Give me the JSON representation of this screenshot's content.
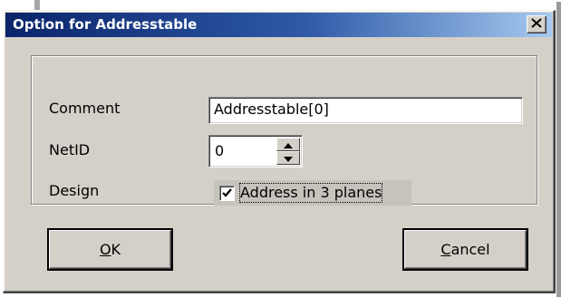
{
  "dialog": {
    "title": "Option for Addresstable",
    "close_icon": "close-x-icon"
  },
  "form": {
    "comment": {
      "label": "Comment",
      "value": "Addresstable[0]"
    },
    "netid": {
      "label": "NetID",
      "value": "0",
      "up_icon": "spin-up-arrow-icon",
      "down_icon": "spin-down-arrow-icon"
    },
    "design": {
      "label": "Design",
      "checkbox_label": "Address in 3 planes",
      "checked": true
    }
  },
  "buttons": {
    "ok": {
      "mnemonic": "O",
      "rest": "K"
    },
    "cancel": {
      "mnemonic": "C",
      "rest": "ancel"
    }
  },
  "colors": {
    "titlebar_start": "#0a246a",
    "titlebar_end": "#a6caf0",
    "dialog_face": "#d4d0c8"
  }
}
